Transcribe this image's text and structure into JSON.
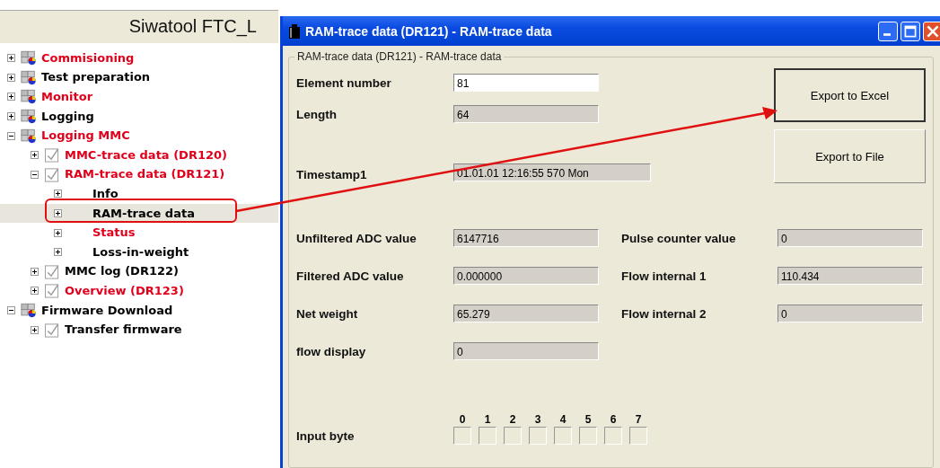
{
  "app_title": "Siwatool FTC_L",
  "tree": [
    {
      "label": "Commisioning",
      "kind": "module",
      "color": "#e0001b",
      "expanded": false,
      "selected": false
    },
    {
      "label": "Test preparation",
      "kind": "module",
      "color": "#000000",
      "expanded": false,
      "selected": false
    },
    {
      "label": "Monitor",
      "kind": "module",
      "color": "#e0001b",
      "expanded": false,
      "selected": false
    },
    {
      "label": "Logging",
      "kind": "module",
      "color": "#000000",
      "expanded": false,
      "selected": false
    },
    {
      "label": "Logging MMC",
      "kind": "module",
      "color": "#e0001b",
      "expanded": true,
      "selected": false,
      "children": [
        {
          "label": "MMC-trace data (DR120)",
          "kind": "record",
          "color": "#e0001b",
          "expanded": false,
          "selected": false
        },
        {
          "label": "RAM-trace data (DR121)",
          "kind": "record",
          "color": "#e0001b",
          "expanded": true,
          "selected": false,
          "children": [
            {
              "label": "Info",
              "kind": "page",
              "color": "#000000",
              "expanded": false,
              "selected": false
            },
            {
              "label": "RAM-trace data",
              "kind": "page",
              "color": "#000000",
              "expanded": false,
              "selected": true
            },
            {
              "label": "Status",
              "kind": "page",
              "color": "#e0001b",
              "expanded": false,
              "selected": false
            },
            {
              "label": "Loss-in-weight",
              "kind": "page",
              "color": "#000000",
              "expanded": false,
              "selected": false
            }
          ]
        },
        {
          "label": "MMC log (DR122)",
          "kind": "record",
          "color": "#000000",
          "expanded": false,
          "selected": false
        },
        {
          "label": "Overview (DR123)",
          "kind": "record",
          "color": "#e0001b",
          "expanded": false,
          "selected": false
        }
      ]
    },
    {
      "label": "Firmware Download",
      "kind": "module",
      "color": "#000000",
      "expanded": true,
      "selected": false,
      "children": [
        {
          "label": "Transfer firmware",
          "kind": "record",
          "color": "#000000",
          "expanded": false,
          "selected": false
        }
      ]
    }
  ],
  "dialog": {
    "title": "RAM-trace data (DR121) - RAM-trace data",
    "group_title": "RAM-trace data (DR121) - RAM-trace data",
    "top_fields": [
      {
        "label": "Element number",
        "value": "81",
        "disabled": false
      },
      {
        "label": "Length",
        "value": "64",
        "disabled": true
      },
      {
        "label": "Timestamp1",
        "value": "01.01.01 12:16:55 570 Mon",
        "disabled": true
      }
    ],
    "buttons": [
      {
        "label": "Export to Excel",
        "focused": true
      },
      {
        "label": "Export to File",
        "focused": false
      }
    ],
    "left_fields": [
      {
        "label": "Unfiltered ADC value",
        "value": "6147716",
        "disabled": true
      },
      {
        "label": "Filtered ADC value",
        "value": "0.000000",
        "disabled": true
      },
      {
        "label": "Net weight",
        "value": "65.279",
        "disabled": true
      },
      {
        "label": "flow display",
        "value": "0",
        "disabled": true
      }
    ],
    "right_fields": [
      {
        "label": "Pulse counter value",
        "value": "0",
        "disabled": true
      },
      {
        "label": "Flow internal 1",
        "value": "110.434",
        "disabled": true
      },
      {
        "label": "Flow internal 2",
        "value": "0",
        "disabled": true
      }
    ],
    "input_byte": {
      "label": "Input byte",
      "bits": [
        {
          "label": "0",
          "checked": false
        },
        {
          "label": "1",
          "checked": false
        },
        {
          "label": "2",
          "checked": false
        },
        {
          "label": "3",
          "checked": false
        },
        {
          "label": "4",
          "checked": false
        },
        {
          "label": "5",
          "checked": false
        },
        {
          "label": "6",
          "checked": false
        },
        {
          "label": "7",
          "checked": false
        }
      ]
    }
  }
}
